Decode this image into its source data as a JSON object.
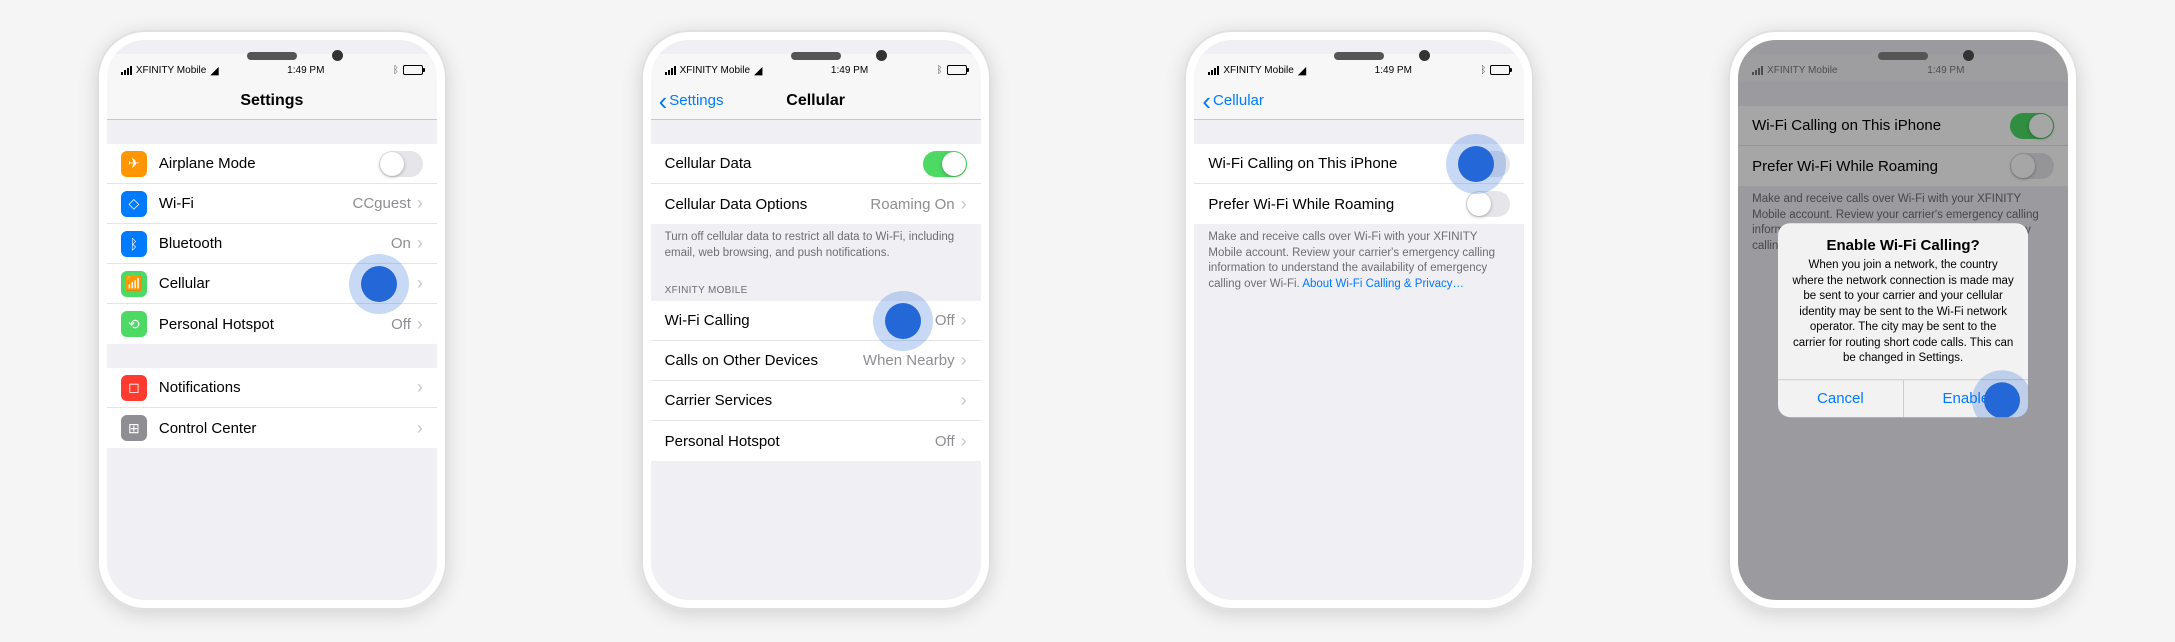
{
  "status_bar": {
    "carrier": "XFINITY Mobile",
    "time": "1:49 PM"
  },
  "screen1": {
    "title": "Settings",
    "rows": {
      "airplane": "Airplane Mode",
      "wifi": "Wi-Fi",
      "wifi_detail": "CCguest",
      "bluetooth": "Bluetooth",
      "bt_detail": "On",
      "cellular": "Cellular",
      "hotspot": "Personal Hotspot",
      "hotspot_detail": "Off",
      "notifications": "Notifications",
      "control_center": "Control Center"
    }
  },
  "screen2": {
    "back": "Settings",
    "title": "Cellular",
    "rows": {
      "cellular_data": "Cellular Data",
      "data_options": "Cellular Data Options",
      "data_options_detail": "Roaming On",
      "footer1": "Turn off cellular data to restrict all data to Wi-Fi, including email, web browsing, and push notifications.",
      "section_header": "XFINITY MOBILE",
      "wifi_calling": "Wi-Fi Calling",
      "wifi_calling_detail": "Off",
      "other_devices": "Calls on Other Devices",
      "other_devices_detail": "When Nearby",
      "carrier_services": "Carrier Services",
      "personal_hotspot": "Personal Hotspot",
      "personal_hotspot_detail": "Off"
    }
  },
  "screen3": {
    "back": "Cellular",
    "rows": {
      "wifi_calling_iphone": "Wi-Fi Calling on This iPhone",
      "prefer_roaming": "Prefer Wi-Fi While Roaming",
      "footer": "Make and receive calls over Wi-Fi with your XFINITY Mobile account. Review your carrier's emergency calling information to understand the availability of emergency calling over Wi-Fi. ",
      "footer_link": "About Wi-Fi Calling & Privacy…"
    }
  },
  "screen4": {
    "rows": {
      "wifi_calling_iphone": "Wi-Fi Calling on This iPhone",
      "prefer_roaming": "Prefer Wi-Fi While Roaming",
      "footer": "Make and receive calls over Wi-Fi with your XFINITY Mobile account. Review your carrier's emergency calling information to understand the availability of emergency calling over Wi-Fi."
    },
    "alert": {
      "title": "Enable Wi-Fi Calling?",
      "body": "When you join a network, the country where the network connection is made may be sent to your carrier and your cellular identity may be sent to the Wi-Fi network operator. The city may be sent to the carrier for routing short code calls. This can be changed in Settings.",
      "cancel": "Cancel",
      "enable": "Enable"
    }
  }
}
